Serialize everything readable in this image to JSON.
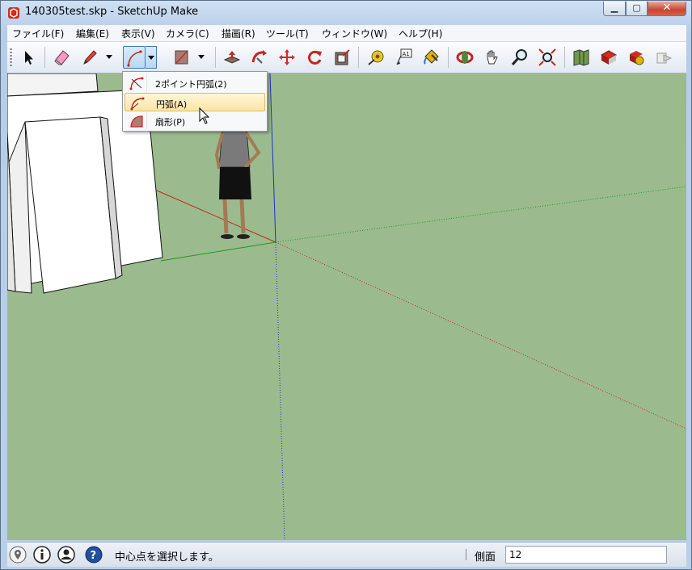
{
  "window": {
    "title": "140305test.skp - SketchUp Make"
  },
  "menu": [
    "ファイル(F)",
    "編集(E)",
    "表示(V)",
    "カメラ(C)",
    "描画(R)",
    "ツール(T)",
    "ウィンドウ(W)",
    "ヘルプ(H)"
  ],
  "toolbar": {
    "tools": [
      "select-icon",
      "eraser-icon",
      "pencil-line-icon",
      "arc-icon",
      "rectangle-icon",
      "push-pull-icon",
      "follow-me-icon",
      "move-icon",
      "rotate-icon",
      "offset-icon",
      "tape-measure-icon",
      "text-icon",
      "paint-bucket-icon",
      "orbit-icon",
      "pan-icon",
      "zoom-icon",
      "zoom-extents-icon",
      "3d-warehouse-icon",
      "extension-warehouse-icon",
      "share-model-icon",
      "layout-send-icon"
    ],
    "text_tool_label": "A1"
  },
  "arc_dropdown": {
    "items": [
      {
        "label": "2ポイント円弧(2)",
        "icon": "two-point-arc-icon",
        "highlighted": false
      },
      {
        "label": "円弧(A)",
        "icon": "arc-icon",
        "highlighted": true
      },
      {
        "label": "扇形(P)",
        "icon": "pie-icon",
        "highlighted": false
      }
    ]
  },
  "statusbar": {
    "hint": "中心点を選択します。",
    "measure_label": "側面",
    "measure_value": "12",
    "icons": [
      "geo-location-icon",
      "info-icon",
      "user-icon",
      "help-icon"
    ]
  },
  "colors": {
    "viewport_bg": "#9bbb8e",
    "axis_red": "#c0281e",
    "axis_green": "#1c9a1c",
    "axis_blue": "#2230c8",
    "highlight": "#fde4a3"
  }
}
